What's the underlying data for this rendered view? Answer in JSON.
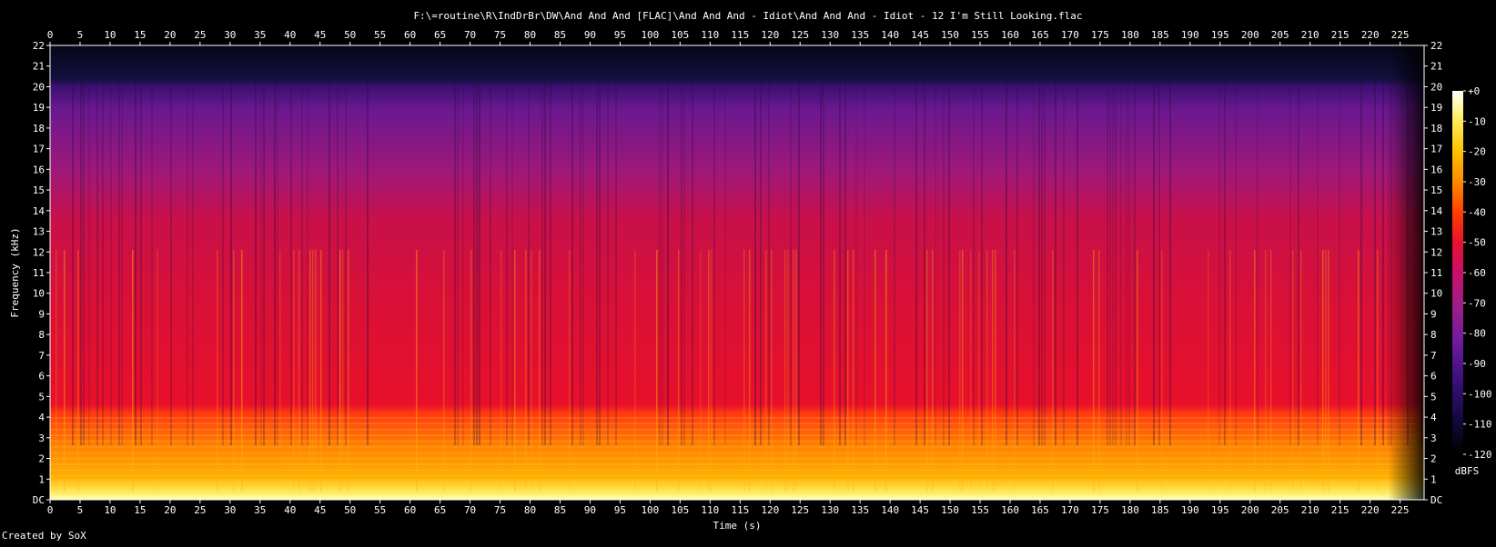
{
  "chart_data": {
    "type": "heatmap",
    "title": "F:\\=routine\\R\\IndDrBr\\DW\\And And And [FLAC]\\And And And - Idiot\\And And And - Idiot - 12 I'm Still Looking.flac",
    "xlabel": "Time (s)",
    "ylabel": "Frequency (kHz)",
    "xlim": [
      0,
      229
    ],
    "ylim": [
      0,
      22
    ],
    "x_ticks": [
      "0",
      "5",
      "10",
      "15",
      "20",
      "25",
      "30",
      "35",
      "40",
      "45",
      "50",
      "55",
      "60",
      "65",
      "70",
      "75",
      "80",
      "85",
      "90",
      "95",
      "100",
      "105",
      "110",
      "115",
      "120",
      "125",
      "130",
      "135",
      "140",
      "145",
      "150",
      "155",
      "160",
      "165",
      "170",
      "175",
      "180",
      "185",
      "190",
      "195",
      "200",
      "205",
      "210",
      "215",
      "220",
      "225"
    ],
    "y_ticks": [
      "DC",
      "1",
      "2",
      "3",
      "4",
      "5",
      "6",
      "7",
      "8",
      "9",
      "10",
      "11",
      "12",
      "13",
      "14",
      "15",
      "16",
      "17",
      "18",
      "19",
      "20",
      "21",
      "22"
    ],
    "colorbar": {
      "label": "dBFS",
      "range": [
        -120,
        0
      ],
      "ticks": [
        "+0",
        "-10",
        "-20",
        "-30",
        "-40",
        "-50",
        "-60",
        "-70",
        "-80",
        "-90",
        "-100",
        "-110",
        "-120"
      ],
      "colors": [
        "#000000",
        "#0f0a3a",
        "#3a0f78",
        "#6a1aa0",
        "#9a1f8a",
        "#c8106a",
        "#e81030",
        "#ff3a00",
        "#ff8a00",
        "#ffc400",
        "#fff070",
        "#ffffff"
      ]
    },
    "spectral_profile_db": [
      {
        "freq_khz": 0.5,
        "db": -8
      },
      {
        "freq_khz": 2,
        "db": -25
      },
      {
        "freq_khz": 4,
        "db": -38
      },
      {
        "freq_khz": 7,
        "db": -50
      },
      {
        "freq_khz": 10,
        "db": -55
      },
      {
        "freq_khz": 14,
        "db": -62
      },
      {
        "freq_khz": 17,
        "db": -75
      },
      {
        "freq_khz": 20,
        "db": -88
      },
      {
        "freq_khz": 21,
        "db": -115
      }
    ],
    "audio_end_s": 225
  },
  "footer": {
    "credit": "Created by SoX"
  }
}
